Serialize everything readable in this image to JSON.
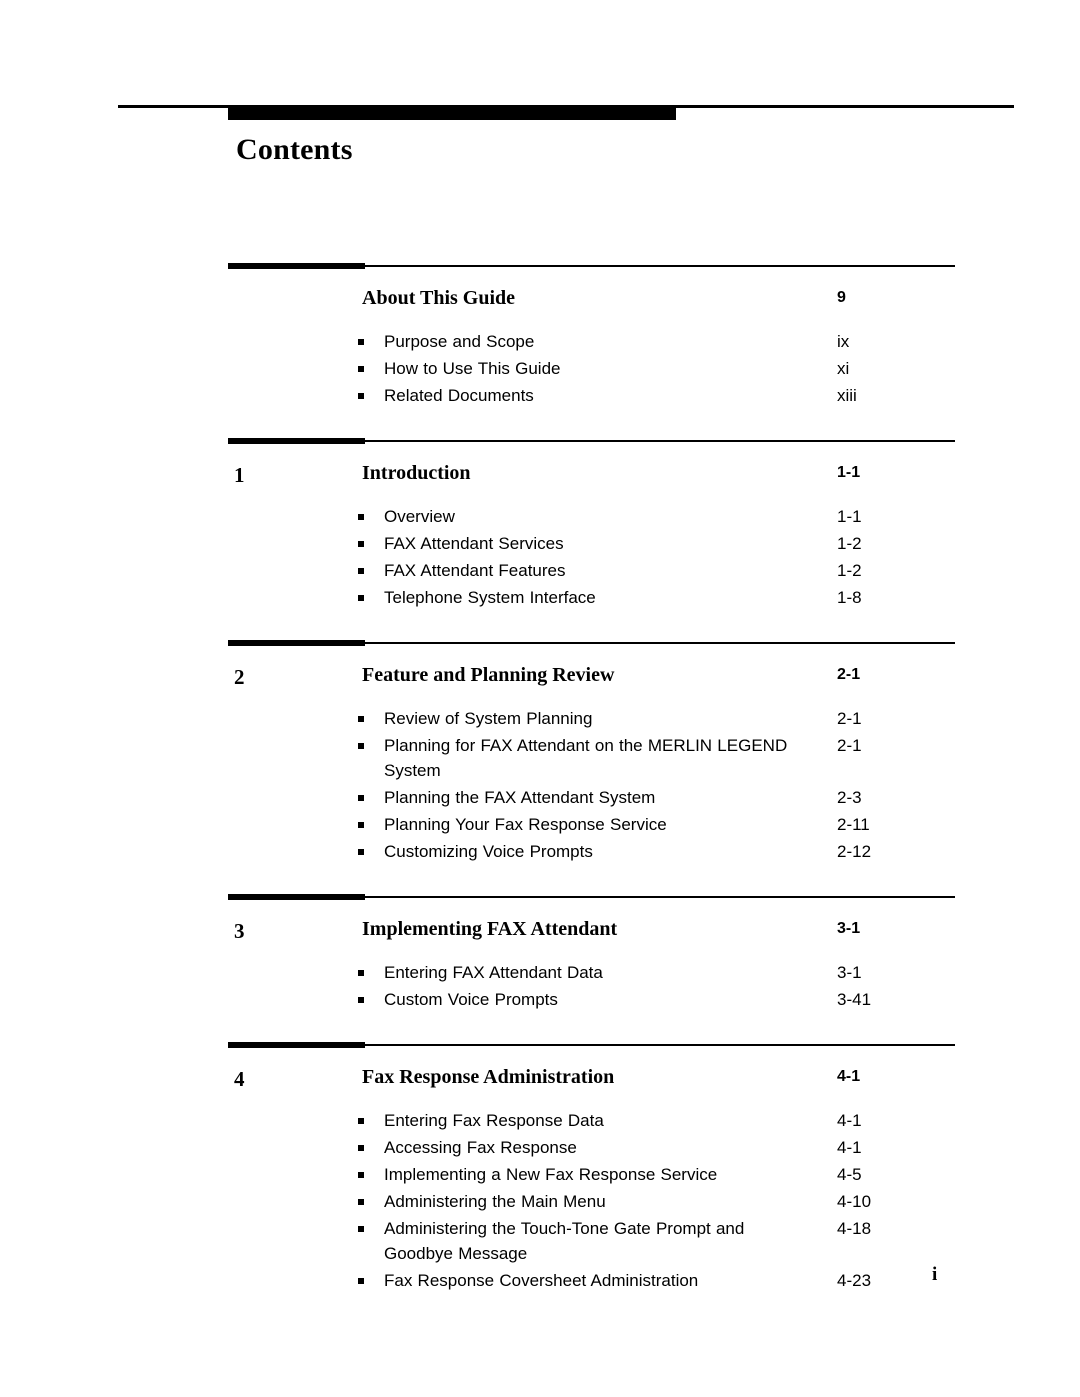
{
  "document": {
    "title": "Contents",
    "footer_page_number": "i"
  },
  "sections": [
    {
      "chapter": "",
      "title": "About This Guide",
      "page": "9",
      "entries": [
        {
          "label": "Purpose and Scope",
          "page": "ix"
        },
        {
          "label": "How to Use This Guide",
          "page": "xi"
        },
        {
          "label": "Related Documents",
          "page": "xiii"
        }
      ]
    },
    {
      "chapter": "1",
      "title": "Introduction",
      "page": "1-1",
      "entries": [
        {
          "label": "Overview",
          "page": "1-1"
        },
        {
          "label": "FAX Attendant Services",
          "page": "1-2"
        },
        {
          "label": "FAX Attendant Features",
          "page": "1-2"
        },
        {
          "label": "Telephone System Interface",
          "page": "1-8"
        }
      ]
    },
    {
      "chapter": "2",
      "title": "Feature and Planning Review",
      "page": "2-1",
      "entries": [
        {
          "label": "Review of System Planning",
          "page": "2-1"
        },
        {
          "label": "Planning for FAX Attendant on the MERLIN LEGEND System",
          "page": "2-1"
        },
        {
          "label": "Planning the FAX Attendant System",
          "page": "2-3"
        },
        {
          "label": "Planning Your Fax Response Service",
          "page": "2-11"
        },
        {
          "label": "Customizing Voice Prompts",
          "page": "2-12"
        }
      ]
    },
    {
      "chapter": "3",
      "title": "Implementing FAX Attendant",
      "page": "3-1",
      "entries": [
        {
          "label": "Entering FAX Attendant Data",
          "page": "3-1"
        },
        {
          "label": "Custom Voice Prompts",
          "page": "3-41"
        }
      ]
    },
    {
      "chapter": "4",
      "title": "Fax Response Administration",
      "page": "4-1",
      "entries": [
        {
          "label": "Entering Fax Response Data",
          "page": "4-1"
        },
        {
          "label": "Accessing Fax Response",
          "page": "4-1"
        },
        {
          "label": "Implementing a New Fax Response Service",
          "page": "4-5"
        },
        {
          "label": "Administering the Main Menu",
          "page": "4-10"
        },
        {
          "label": "Administering the Touch-Tone Gate Prompt and Goodbye Message",
          "page": "4-18"
        },
        {
          "label": "Fax Response Coversheet Administration",
          "page": "4-23"
        }
      ]
    }
  ]
}
